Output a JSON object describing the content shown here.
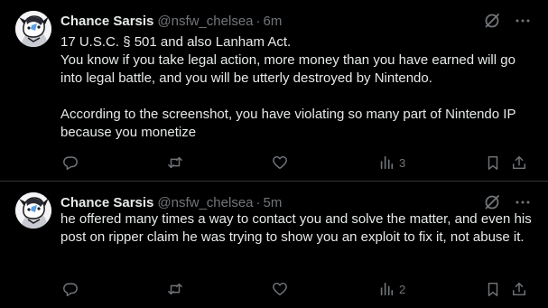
{
  "colors": {
    "background": "#000000",
    "text": "#e7e9ea",
    "muted": "#71767b",
    "divider": "#2f3336"
  },
  "tweets": [
    {
      "author_name": "Chance Sarsis",
      "handle": "@nsfw_chelsea",
      "separator": "·",
      "time": "6m",
      "lines": [
        "17 U.S.C. § 501  and also Lanham Act.",
        "You know if you take legal action, more money than you have earned will go into legal battle, and you will be utterly destroyed by Nintendo.",
        "",
        "According to the screenshot, you have violating so many part of Nintendo IP because you monetize"
      ],
      "views": "3",
      "icons": [
        "grok-icon",
        "more-icon",
        "reply-icon",
        "retweet-icon",
        "like-icon",
        "views-icon",
        "bookmark-icon",
        "share-icon"
      ]
    },
    {
      "author_name": "Chance Sarsis",
      "handle": "@nsfw_chelsea",
      "separator": "·",
      "time": "5m",
      "lines": [
        "he offered many times a way to contact you and solve the matter, and even his post on ripper claim he was trying to show you an exploit to fix it, not abuse it."
      ],
      "views": "2",
      "icons": [
        "grok-icon",
        "more-icon",
        "reply-icon",
        "retweet-icon",
        "like-icon",
        "views-icon",
        "bookmark-icon",
        "share-icon"
      ]
    }
  ]
}
